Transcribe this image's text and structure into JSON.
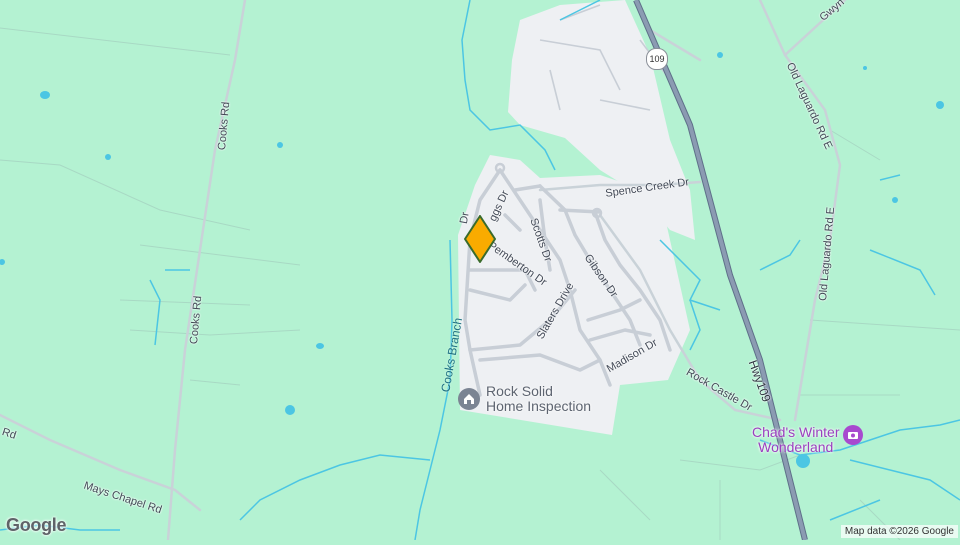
{
  "map": {
    "colors": {
      "land": "#b4f2d2",
      "developed_area": "#eef0f3",
      "road": "#c8ced6",
      "highway": "#7d8da3",
      "water": "#4cc6e3",
      "marker": "#f9ab00"
    },
    "roads": {
      "cooks_rd_north": "Cooks Rd",
      "cooks_rd_south": "Cooks Rd",
      "mays_chapel_rd": "Mays Chapel Rd",
      "mays_chapel_partial": "Rd",
      "old_laguardo_rd_e_north": "Old Laguardo Rd E",
      "old_laguardo_rd_e_south": "Old Laguardo Rd E",
      "gwynn_partial": "Gwyn",
      "spence_creek_dr": "Spence Creek Dr",
      "scotts_dr": "Scotts Dr",
      "pemberton_dr": "Pemberton Dr",
      "partial_dr": "Dr",
      "briggs_partial": "ggs Dr",
      "gibson_dr": "Gibson Dr",
      "slaters_drive": "Slaters Drive",
      "madison_dr": "Madison Dr",
      "rock_castle_dr": "Rock Castle Dr",
      "hwy109": "Hwy109",
      "route_shield": "109"
    },
    "water": {
      "cooks_branch": "Cooks Branch"
    },
    "places": [
      {
        "name": "Rock Solid Home Inspection",
        "line1": "Rock Solid",
        "line2": "Home Inspection",
        "icon": "house-icon"
      },
      {
        "name": "Chad's Winter Wonderland",
        "line1": "Chad's Winter",
        "line2": "Wonderland",
        "icon": "camera-icon"
      }
    ],
    "marker": {
      "icon": "location-marker-icon"
    },
    "logo": "Google",
    "attribution": "Map data ©2026 Google"
  }
}
